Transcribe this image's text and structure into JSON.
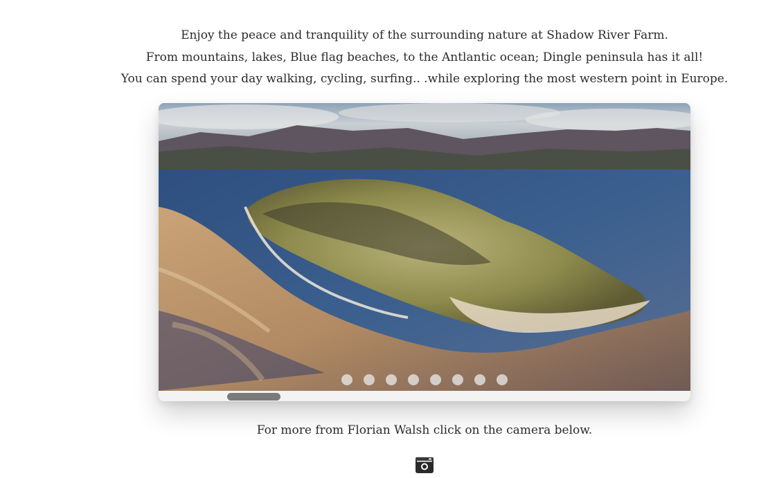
{
  "intro": {
    "lines": [
      "Enjoy the peace and tranquility of the surrounding nature at Shadow River Farm.",
      "From mountains, lakes, Blue flag beaches, to the Antlantic ocean; Dingle peninsula has it all!",
      "You can spend your day walking, cycling, surfing.. .while exploring the most western point in Europe."
    ]
  },
  "slider": {
    "image": "aerial-dingle-peninsula-photo",
    "dots_count": 8,
    "active_dot": 1
  },
  "footer": {
    "more_text": "For more from Florian Walsh click on the camera below.",
    "camera_icon": "camera-icon"
  },
  "colors": {
    "text": "#2b2b2b",
    "thumb": "#7a7a7a",
    "dot": "#ebebeb"
  }
}
